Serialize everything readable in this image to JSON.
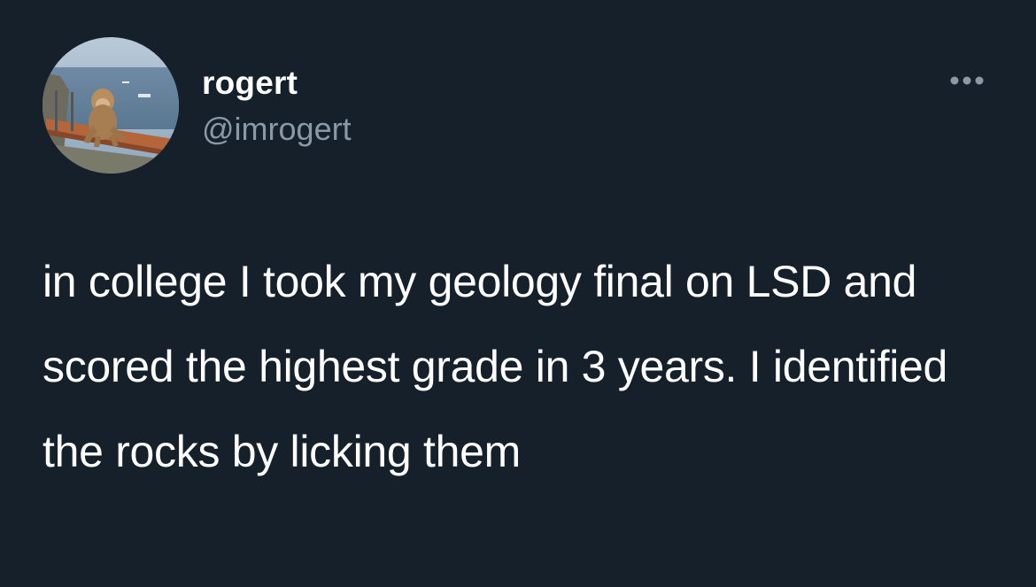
{
  "tweet": {
    "author": {
      "display_name": "rogert",
      "handle": "@imrogert",
      "avatar_icon": "avatar-photo-monkey-on-railing"
    },
    "more_icon": "more-horizontal-icon",
    "text": "in college I took my geology final on LSD and scored the highest grade in 3 years. I identified the rocks by licking them"
  },
  "colors": {
    "background": "#16202b",
    "primary_text": "#ffffff",
    "secondary_text": "#8b98a5"
  }
}
